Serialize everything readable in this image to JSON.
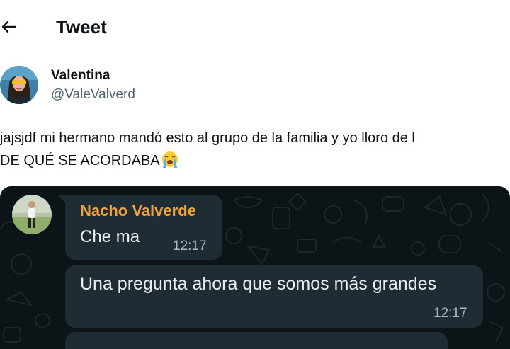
{
  "header": {
    "back_icon": "arrow-left-icon",
    "title": "Tweet"
  },
  "author": {
    "name": "Valentina",
    "handle": "@ValeValverd"
  },
  "tweet": {
    "line1": "jajsjdf mi hermano mandó esto al grupo de la familia y yo lloro de l",
    "line2": "DE QUÉ SE ACORDABA",
    "emoji": "loudly-crying-face-emoji"
  },
  "media": {
    "chat": {
      "sender": "Nacho Valverde",
      "messages": [
        {
          "text": "Che ma",
          "time": "12:17"
        },
        {
          "text": "Una pregunta ahora que somos más grandes",
          "time": "12:17"
        }
      ]
    }
  },
  "colors": {
    "text_primary": "#0f1419",
    "text_secondary": "#536471",
    "chat_background": "#0d1417",
    "chat_bubble": "#202c33",
    "sender_name": "#f0a33a",
    "chat_time": "#aebac1"
  }
}
